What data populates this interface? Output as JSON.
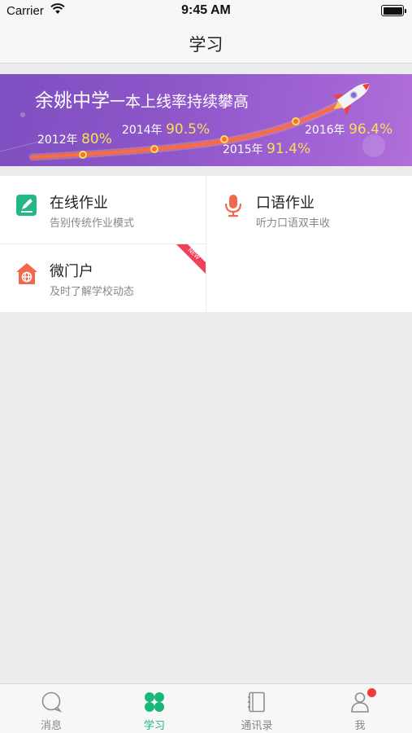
{
  "status_bar": {
    "carrier": "Carrier",
    "time": "9:45 AM"
  },
  "nav": {
    "title": "学习"
  },
  "banner": {
    "title_main": "余姚中学",
    "title_rest": "一本上线率持续攀高",
    "milestones": [
      {
        "year": "2012年",
        "rate": "80%"
      },
      {
        "year": "2014年",
        "rate": "90.5%"
      },
      {
        "year": "2015年",
        "rate": "91.4%"
      },
      {
        "year": "2016年",
        "rate": "96.4%"
      }
    ]
  },
  "cards": [
    {
      "title": "在线作业",
      "subtitle": "告别传统作业模式",
      "icon": "edit-note-icon",
      "color": "#23b884"
    },
    {
      "title": "口语作业",
      "subtitle": "听力口语双丰收",
      "icon": "microphone-icon",
      "color": "#f0684e"
    },
    {
      "title": "微门户",
      "subtitle": "及时了解学校动态",
      "icon": "home-globe-icon",
      "color": "#f0684e",
      "badge": "NEW"
    }
  ],
  "tabs": [
    {
      "label": "消息",
      "icon": "chat-bubble-icon",
      "active": false
    },
    {
      "label": "学习",
      "icon": "four-petal-icon",
      "active": true
    },
    {
      "label": "通讯录",
      "icon": "contact-book-icon",
      "active": false
    },
    {
      "label": "我",
      "icon": "user-icon",
      "active": false,
      "has_badge": true
    }
  ],
  "colors": {
    "accent": "#19b87a",
    "badge": "#f03b3b",
    "banner": "#8d56c9"
  }
}
